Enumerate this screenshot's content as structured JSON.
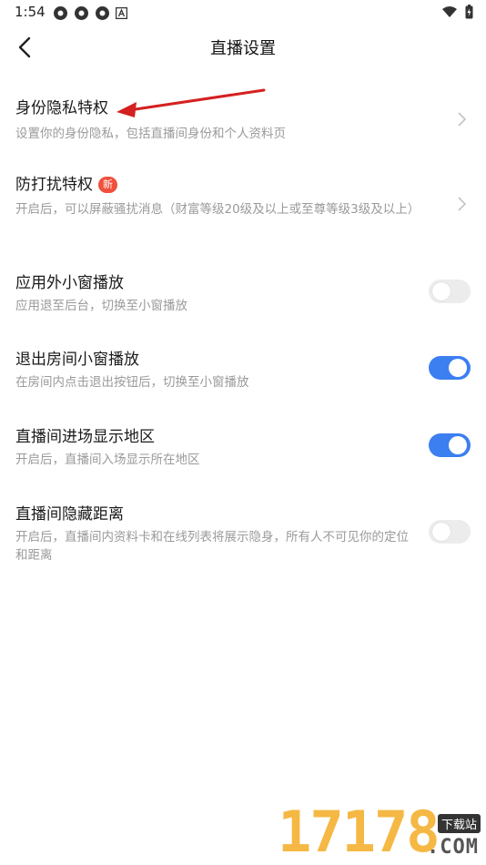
{
  "status_bar": {
    "time": "1:54"
  },
  "header": {
    "title": "直播设置"
  },
  "settings": [
    {
      "label": "身份隐私特权",
      "desc": "设置你的身份隐私，包括直播间身份和个人资料页"
    },
    {
      "label": "防打扰特权",
      "badge": "新",
      "desc": "开启后，可以屏蔽骚扰消息（财富等级20级及以上或至尊等级3级及以上）"
    },
    {
      "label": "应用外小窗播放",
      "desc": "应用退至后台，切换至小窗播放",
      "toggle_on": false
    },
    {
      "label": "退出房间小窗播放",
      "desc": "在房间内点击退出按钮后，切换至小窗播放",
      "toggle_on": true
    },
    {
      "label": "直播间进场显示地区",
      "desc": "开启后，直播间入场显示所在地区",
      "toggle_on": true
    },
    {
      "label": "直播间隐藏距离",
      "desc": "开启后，直播间内资料卡和在线列表将展示隐身，所有人不可见你的定位和距离",
      "toggle_on": false
    }
  ],
  "watermark": {
    "digits": "17178",
    "tag": "下载站",
    "domain": ".COM"
  },
  "colors": {
    "accent": "#3b7ff0",
    "badge": "#f0503c",
    "arrow": "#d42020"
  }
}
